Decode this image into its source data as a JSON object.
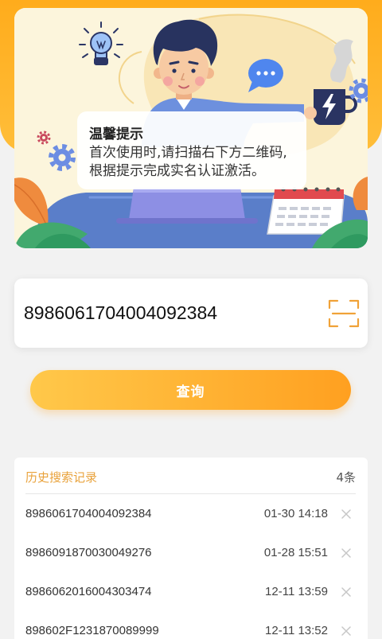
{
  "colors": {
    "header_orange": "#ffb326",
    "accent": "#f0a238",
    "button_gradient_start": "#ffc84a",
    "button_gradient_end": "#ffa020",
    "history_title": "#e9a23b",
    "page_background": "#f2f2f2"
  },
  "banner": {
    "tip_title": "温馨提示",
    "tip_line1": "首次使用时,请扫描右下方二维码,",
    "tip_line2": "根据提示完成实名认证激活。",
    "illustration_icons": [
      "lightbulb-icon",
      "gear-icon",
      "chat-bubble-icon",
      "coffee-mug-icon",
      "calendar-icon"
    ]
  },
  "search": {
    "value": "8986061704004092384",
    "scan_icon": "scan-icon"
  },
  "query_button": {
    "label": "查询"
  },
  "history": {
    "title": "历史搜索记录",
    "count": "4条",
    "delete_icon": "close-icon",
    "items": [
      {
        "number": "8986061704004092384",
        "time": "01-30 14:18"
      },
      {
        "number": "8986091870030049276",
        "time": "01-28 15:51"
      },
      {
        "number": "8986062016004303474",
        "time": "12-11 13:59"
      },
      {
        "number": "898602F1231870089999",
        "time": "12-11 13:52"
      }
    ]
  }
}
